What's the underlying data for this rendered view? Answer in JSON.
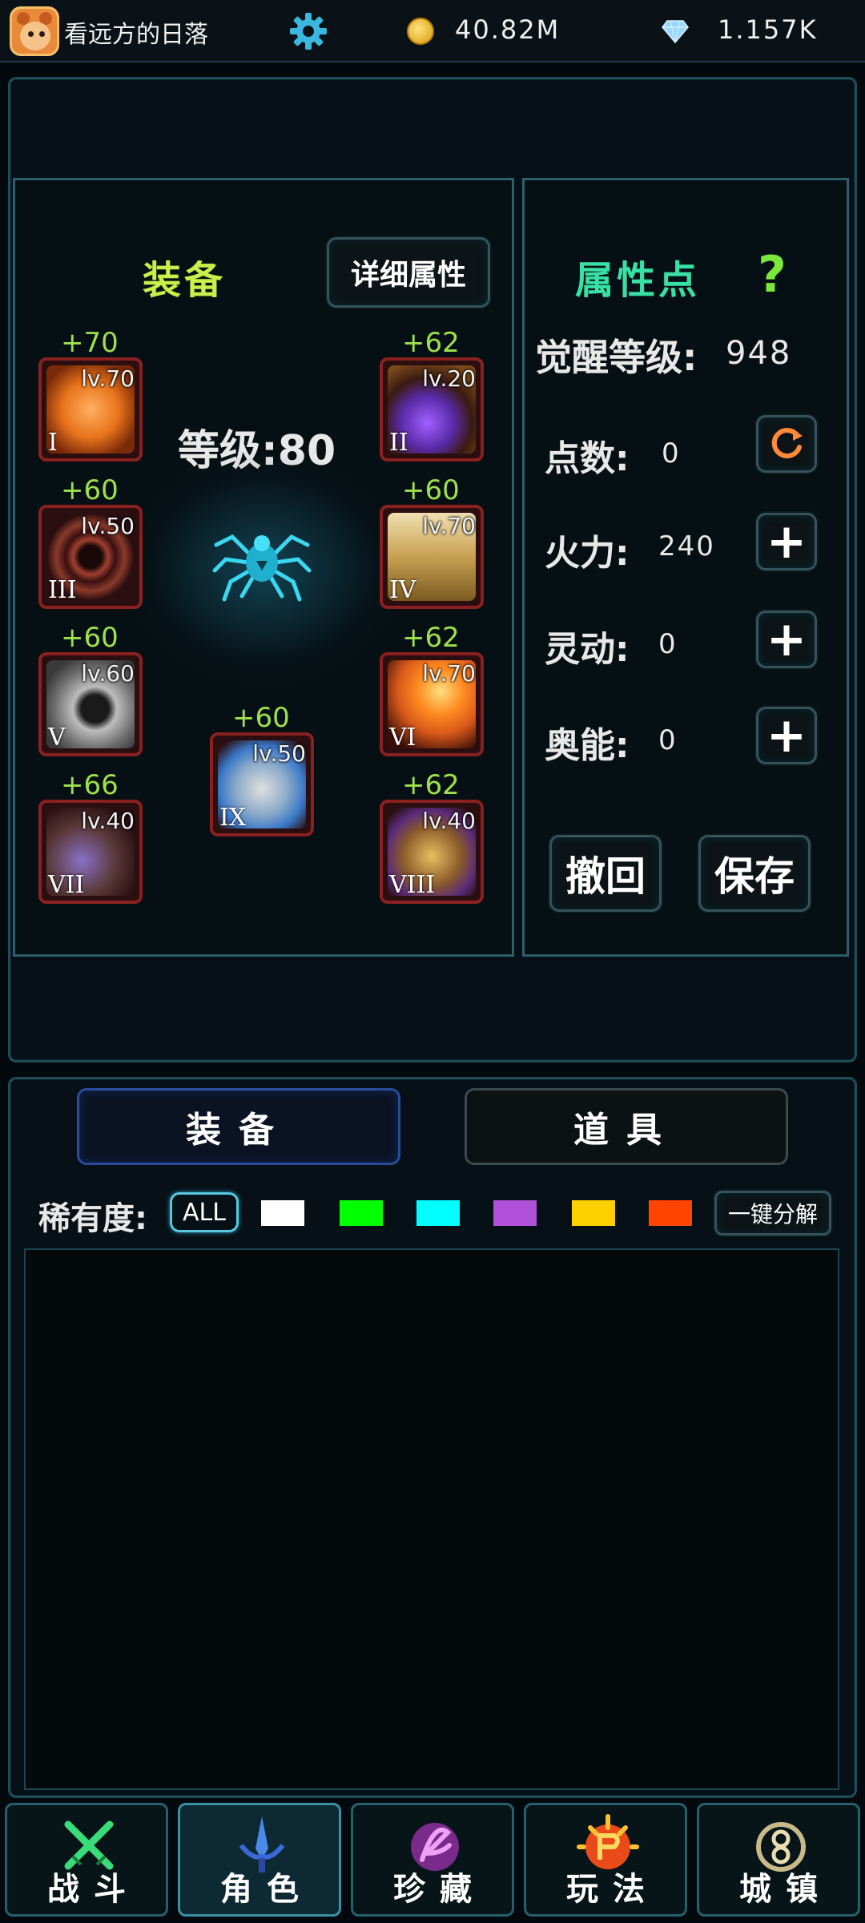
{
  "topbar": {
    "username": "看远方的日落",
    "gold": "40.82M",
    "gems": "1.157K"
  },
  "equipment": {
    "title": "装备",
    "detail_button": "详细属性",
    "level_label": "等级:80",
    "slots": [
      {
        "roman": "I",
        "level": "lv.70",
        "bonus": "+70",
        "art_color": "#e8741c"
      },
      {
        "roman": "II",
        "level": "lv.20",
        "bonus": "+62",
        "art_color": "#5a2aa8"
      },
      {
        "roman": "III",
        "level": "lv.50",
        "bonus": "+60",
        "art_color": "#7a2a24"
      },
      {
        "roman": "IV",
        "level": "lv.70",
        "bonus": "+60",
        "art_color": "#c8a052"
      },
      {
        "roman": "V",
        "level": "lv.60",
        "bonus": "+60",
        "art_color": "#6a6a6a"
      },
      {
        "roman": "VI",
        "level": "lv.70",
        "bonus": "+62",
        "art_color": "#d8581a"
      },
      {
        "roman": "VII",
        "level": "lv.40",
        "bonus": "+66",
        "art_color": "#5a3a3a"
      },
      {
        "roman": "VIII",
        "level": "lv.40",
        "bonus": "+62",
        "art_color": "#8a5a2a"
      },
      {
        "roman": "IX",
        "level": "lv.50",
        "bonus": "+60",
        "art_color": "#8aaac8"
      }
    ]
  },
  "attributes": {
    "title": "属性点",
    "help_icon": "?",
    "awaken_label": "觉醒等级:",
    "awaken_value": "948",
    "stats": [
      {
        "label": "点数:",
        "value": "0",
        "button": "reset"
      },
      {
        "label": "火力:",
        "value": "240",
        "button": "+"
      },
      {
        "label": "灵动:",
        "value": "0",
        "button": "+"
      },
      {
        "label": "奥能:",
        "value": "0",
        "button": "+"
      }
    ],
    "undo_button": "撤回",
    "save_button": "保存"
  },
  "inventory": {
    "tab_equipment": "装备",
    "tab_items": "道具",
    "rarity_label": "稀有度:",
    "all_filter": "ALL",
    "rarity_colors": [
      "#ffffff",
      "#00ff00",
      "#00ffff",
      "#b050d8",
      "#ffd000",
      "#ff4400"
    ],
    "decompose_button": "一键分解"
  },
  "nav": [
    {
      "label": "战斗",
      "icon": "crossed-swords-icon",
      "active": false
    },
    {
      "label": "角色",
      "icon": "sword-icon",
      "active": true
    },
    {
      "label": "珍藏",
      "icon": "treasure-icon",
      "active": false
    },
    {
      "label": "玩法",
      "icon": "gameplay-icon",
      "active": false
    },
    {
      "label": "城镇",
      "icon": "town-icon",
      "active": false
    }
  ]
}
